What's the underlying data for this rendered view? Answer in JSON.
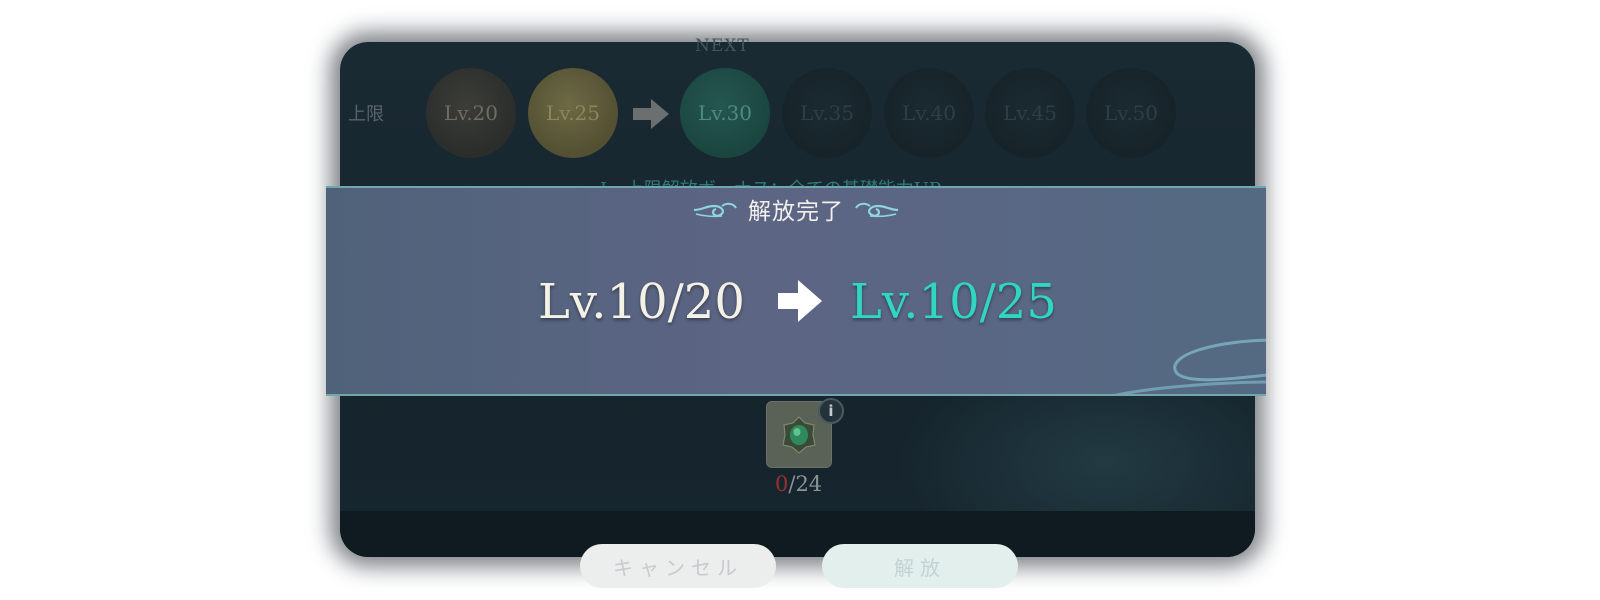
{
  "header": {
    "next_label": "NEXT",
    "limit_label": "上限"
  },
  "level_caps": [
    {
      "label": "Lv.20",
      "state": "unlocked"
    },
    {
      "label": "Lv.25",
      "state": "unlocked"
    },
    {
      "label": "Lv.30",
      "state": "next"
    },
    {
      "label": "Lv.35",
      "state": "locked"
    },
    {
      "label": "Lv.40",
      "state": "locked"
    },
    {
      "label": "Lv.45",
      "state": "locked"
    },
    {
      "label": "Lv.50",
      "state": "locked"
    }
  ],
  "bonus_text": "Lv.上限解放ボーナス：全ての基礎能力UP",
  "banner": {
    "title": "解放完了",
    "from_level": "Lv.10/20",
    "to_level": "Lv.10/25"
  },
  "material": {
    "icon": "green-gem-icon",
    "have": "0",
    "need": "/24"
  },
  "buttons": {
    "cancel": "キャンセル",
    "confirm": "解放"
  },
  "colors": {
    "accent_teal": "#2fd6c3",
    "banner_border": "#6fa7ad",
    "insufficient_red": "#9a2f2f"
  }
}
